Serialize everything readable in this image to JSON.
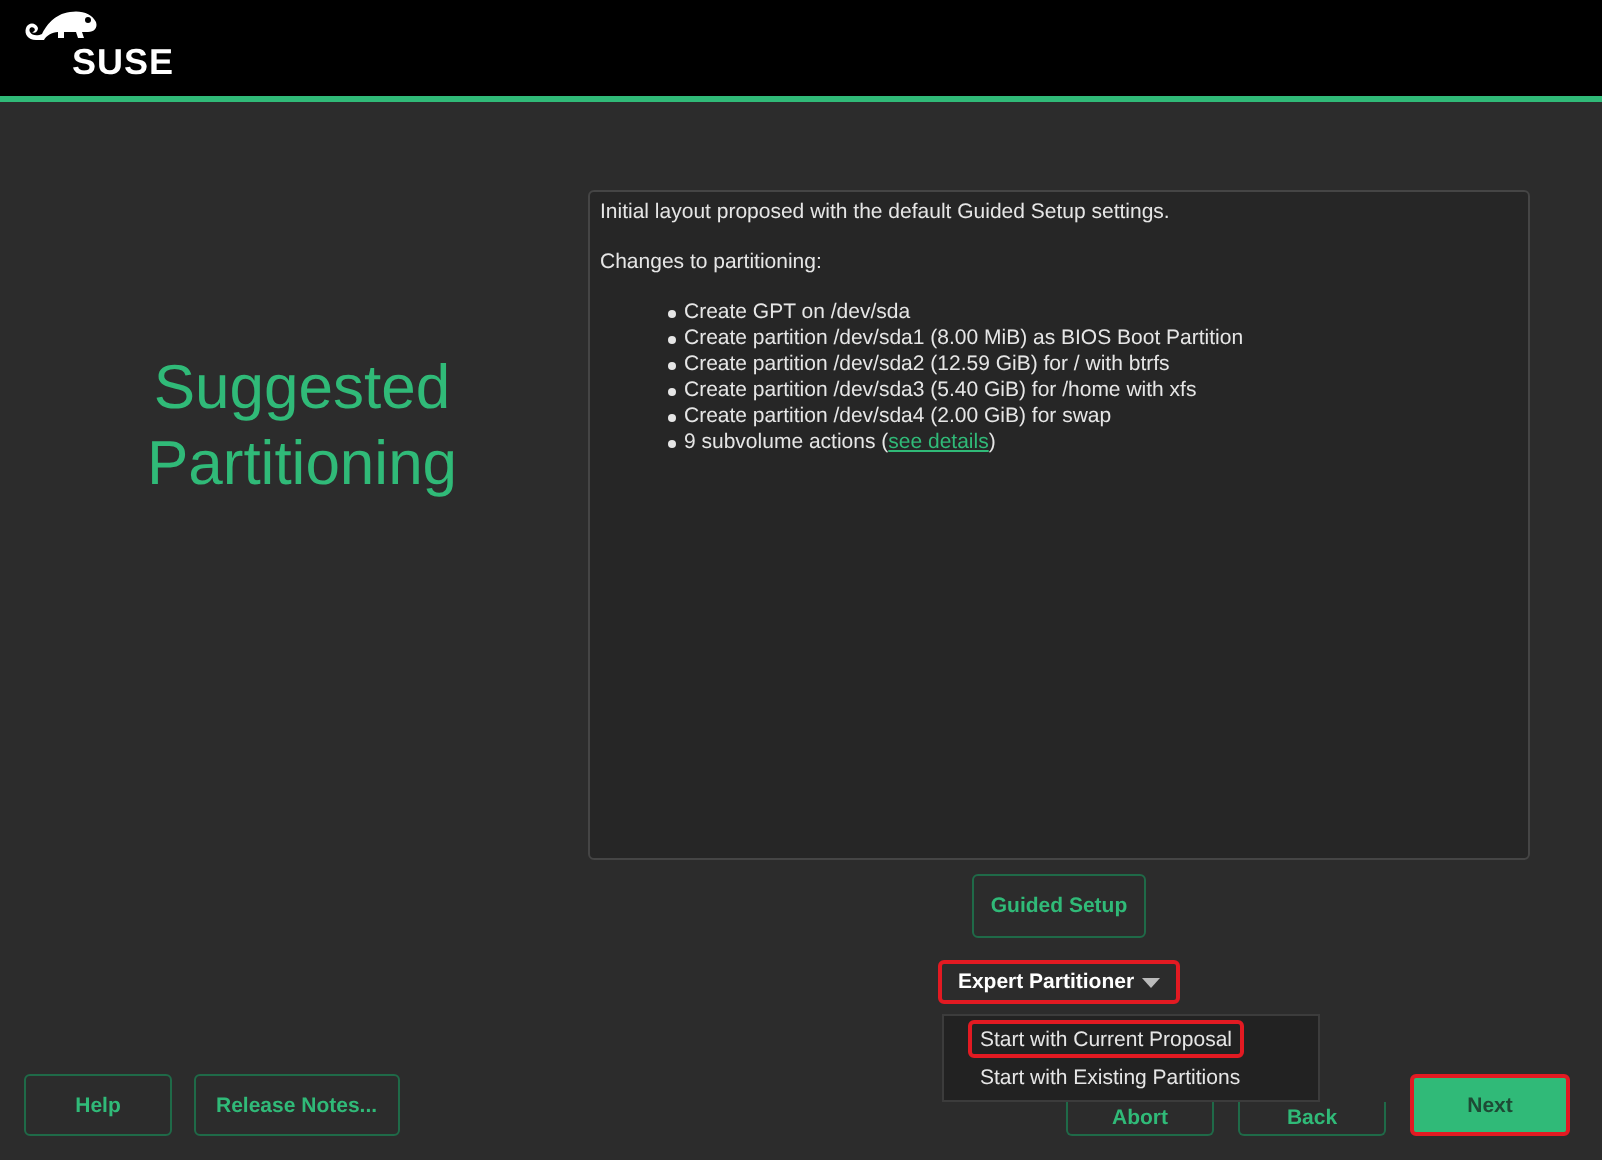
{
  "header": {
    "logo": "SUSE"
  },
  "title": "Suggested Partitioning",
  "summary": {
    "intro": "Initial layout proposed with the default Guided Setup settings.",
    "heading": "Changes to partitioning:",
    "items": [
      {
        "text": "Create GPT on /dev/sda"
      },
      {
        "text": "Create partition /dev/sda1 (8.00 MiB) as BIOS Boot Partition"
      },
      {
        "text": "Create partition /dev/sda2 (12.59 GiB) for / with btrfs"
      },
      {
        "text": "Create partition /dev/sda3 (5.40 GiB) for /home with xfs"
      },
      {
        "text": "Create partition /dev/sda4 (2.00 GiB) for swap"
      },
      {
        "text": "9 subvolume actions (",
        "link": "see details",
        "after": ")"
      }
    ]
  },
  "guided_setup": {
    "label": "Guided Setup"
  },
  "expert_partitioner": {
    "label": "Expert Partitioner",
    "highlighted": true,
    "expanded": true,
    "menu": [
      {
        "label": "Start with Current Proposal",
        "highlighted": true
      },
      {
        "label": "Start with Existing Partitions",
        "highlighted": false
      }
    ]
  },
  "bottom_left": [
    {
      "label": "Help",
      "primary": false,
      "highlighted": false
    },
    {
      "label": "Release Notes...",
      "primary": false,
      "highlighted": false
    }
  ],
  "bottom_right": [
    {
      "label": "Abort",
      "primary": false,
      "highlighted": false
    },
    {
      "label": "Back",
      "primary": false,
      "highlighted": false
    },
    {
      "label": "Next",
      "primary": true,
      "highlighted": true
    }
  ]
}
